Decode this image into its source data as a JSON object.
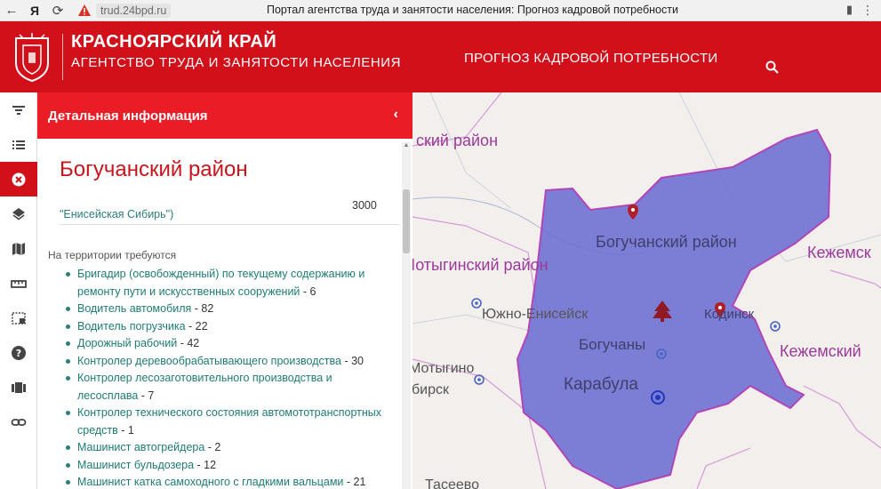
{
  "browser": {
    "yandex": "Я",
    "url": "trud.24bpd.ru",
    "tab_title": "Портал агентства труда и занятости населения: Прогноз кадровой потребности"
  },
  "header": {
    "title": "КРАСНОЯРСКИЙ КРАЙ",
    "subtitle": "АГЕНТСТВО ТРУДА И ЗАНЯТОСТИ НАСЕЛЕНИЯ",
    "nav_forecast": "ПРОГНОЗ КАДРОВОЙ ПОТРЕБНОСТИ"
  },
  "toolbar": {
    "icons": [
      "filter-icon",
      "list-icon",
      "close-icon",
      "layers-icon",
      "map-icon",
      "ruler-icon",
      "select-area-icon",
      "help-icon",
      "books-icon",
      "link-icon"
    ]
  },
  "panel": {
    "title": "Детальная информация",
    "district": "Богучанский район",
    "prev_item_text": "\"Енисейская Сибирь\")",
    "prev_item_number": "3000",
    "required_label": "На территории требуются",
    "jobs": [
      {
        "name": "Бригадир (освобожденный) по текущему содержанию и ремонту пути и искусственных сооружений",
        "count": " - 6"
      },
      {
        "name": "Водитель автомобиля",
        "count": " - 82"
      },
      {
        "name": "Водитель погрузчика",
        "count": " - 22"
      },
      {
        "name": "Дорожный рабочий",
        "count": " - 42"
      },
      {
        "name": "Контролер деревообрабатывающего производства",
        "count": " - 30"
      },
      {
        "name": "Контролер лесозаготовительного производства и лесосплава",
        "count": " - 7"
      },
      {
        "name": "Контролер технического состояния автомототранспортных средств",
        "count": " - 1"
      },
      {
        "name": "Машинист автогрейдера",
        "count": " - 2"
      },
      {
        "name": "Машинист бульдозера",
        "count": " - 12"
      },
      {
        "name": "Машинист катка самоходного с гладкими вальцами",
        "count": " - 21"
      }
    ]
  },
  "map": {
    "labels": {
      "top_district": "ский район",
      "boguchany_district": "Богучанский район",
      "motygino_district": "Мотыгинский район",
      "kezhma_top": "Кежемск",
      "kezhma_district": "Кежемский",
      "yuzhno": "Южно-Енисейск",
      "kodinsk": "Кодинск",
      "boguchany": "Богучаны",
      "motygino": "Мотыгино",
      "karabula": "Карабула",
      "birsk": "бирск",
      "taseevo": "Тасеево"
    },
    "colors": {
      "selected_fill": "#6f70d2",
      "border": "#b245b7",
      "header": "#d1101a"
    }
  }
}
